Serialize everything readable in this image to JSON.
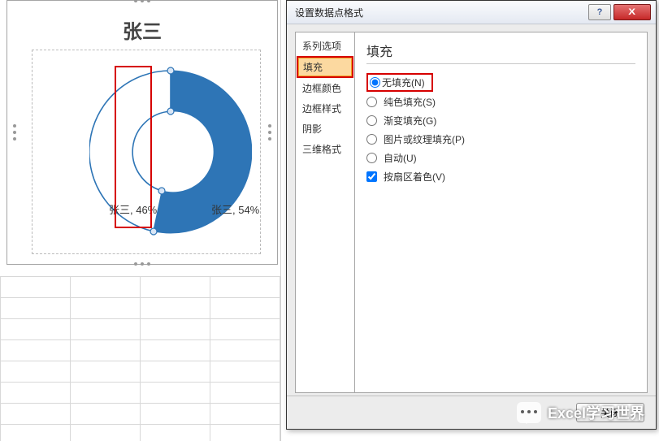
{
  "chart": {
    "title": "张三",
    "labels": {
      "slice1": "张三, 46%",
      "slice2": "张三, 54%"
    }
  },
  "chart_data": {
    "type": "pie",
    "title": "张三",
    "categories": [
      "张三",
      "张三"
    ],
    "values": [
      46,
      54
    ],
    "series": [
      {
        "name": "张三",
        "values": [
          46,
          54
        ]
      }
    ],
    "data_labels_format": "series_name, percent",
    "note": "doughnut; slice 1 currently selected with No Fill"
  },
  "dialog": {
    "title": "设置数据点格式",
    "nav": {
      "series_options": "系列选项",
      "fill": "填充",
      "border_color": "边框颜色",
      "border_style": "边框样式",
      "shadow": "阴影",
      "three_d_format": "三维格式"
    },
    "panel_title": "填充",
    "options": {
      "no_fill": "无填充(N)",
      "solid_fill": "纯色填充(S)",
      "gradient_fill": "渐变填充(G)",
      "picture_texture_fill": "图片或纹理填充(P)",
      "automatic": "自动(U)",
      "vary_by_slice": "按扇区着色(V)"
    },
    "footer": {
      "close": "关闭"
    },
    "window": {
      "help": "?",
      "close": "X"
    }
  },
  "watermark": {
    "text": "Excel学习世界"
  }
}
